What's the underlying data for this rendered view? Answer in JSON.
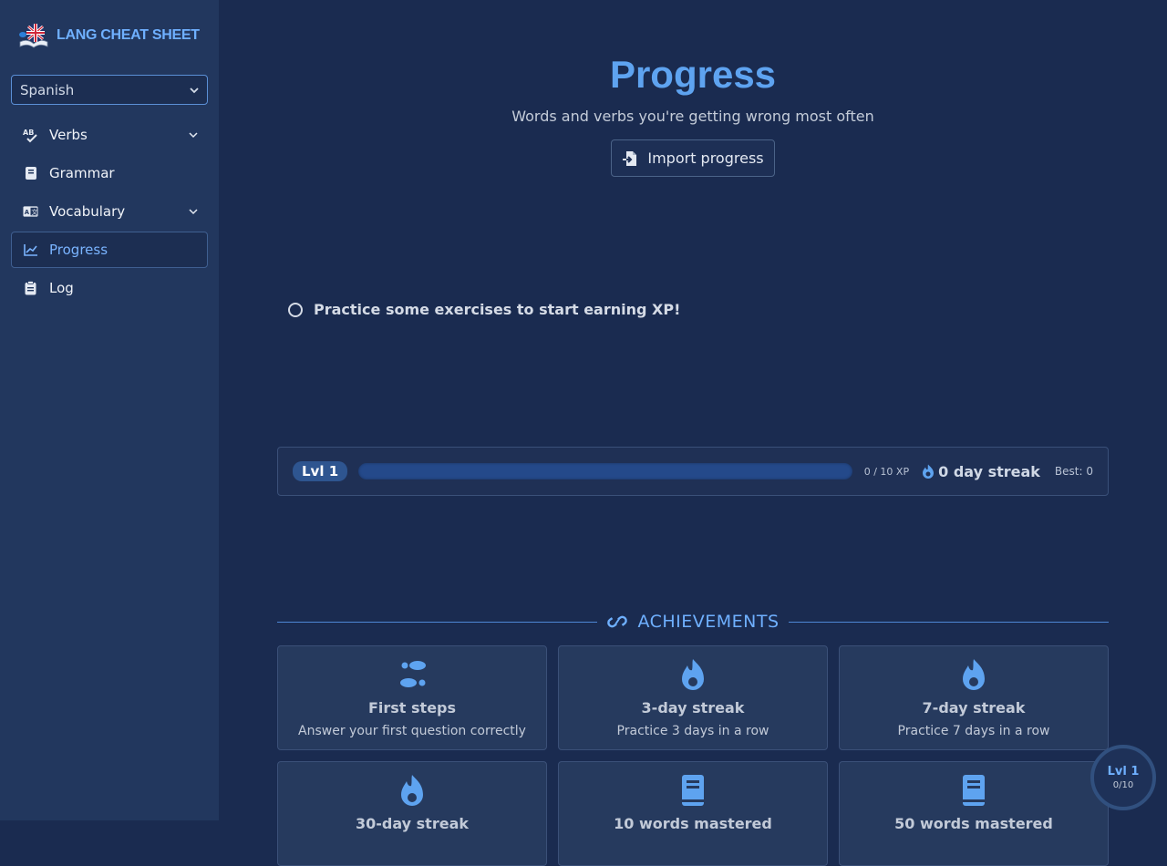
{
  "sidebar": {
    "brand": "LANG CHEAT SHEET",
    "language": "Spanish",
    "items": [
      {
        "label": "Verbs",
        "icon": "spellcheck-icon",
        "expandable": true
      },
      {
        "label": "Grammar",
        "icon": "book-icon",
        "expandable": false
      },
      {
        "label": "Vocabulary",
        "icon": "translate-icon",
        "expandable": true
      },
      {
        "label": "Progress",
        "icon": "chart-line-icon",
        "expandable": false,
        "active": true
      },
      {
        "label": "Log",
        "icon": "clipboard-icon",
        "expandable": false
      }
    ]
  },
  "main": {
    "title": "Progress",
    "subtitle": "Words and verbs you're getting wrong most often",
    "import_label": "Import progress",
    "hint": "Practice some exercises to start earning XP!",
    "level": {
      "badge": "Lvl 1",
      "xp_text": "0 / 10 XP",
      "xp_fraction": 0,
      "streak": "0 day streak",
      "best": "Best: 0"
    },
    "achievements": {
      "title": "ACHIEVEMENTS",
      "cards": [
        {
          "name": "First steps",
          "desc": "Answer your first question correctly",
          "icon": "footprints-icon"
        },
        {
          "name": "3-day streak",
          "desc": "Practice 3 days in a row",
          "icon": "flame-icon"
        },
        {
          "name": "7-day streak",
          "desc": "Practice 7 days in a row",
          "icon": "flame-icon"
        },
        {
          "name": "30-day streak",
          "desc": "",
          "icon": "flame-icon"
        },
        {
          "name": "10 words mastered",
          "desc": "",
          "icon": "book-icon"
        },
        {
          "name": "50 words mastered",
          "desc": "",
          "icon": "book-icon"
        }
      ]
    }
  },
  "floating_level": {
    "label": "Lvl 1",
    "xp": "0/10"
  },
  "colors": {
    "accent": "#6fb0ff",
    "background": "#1a2b50",
    "sidebar": "#22375e"
  }
}
